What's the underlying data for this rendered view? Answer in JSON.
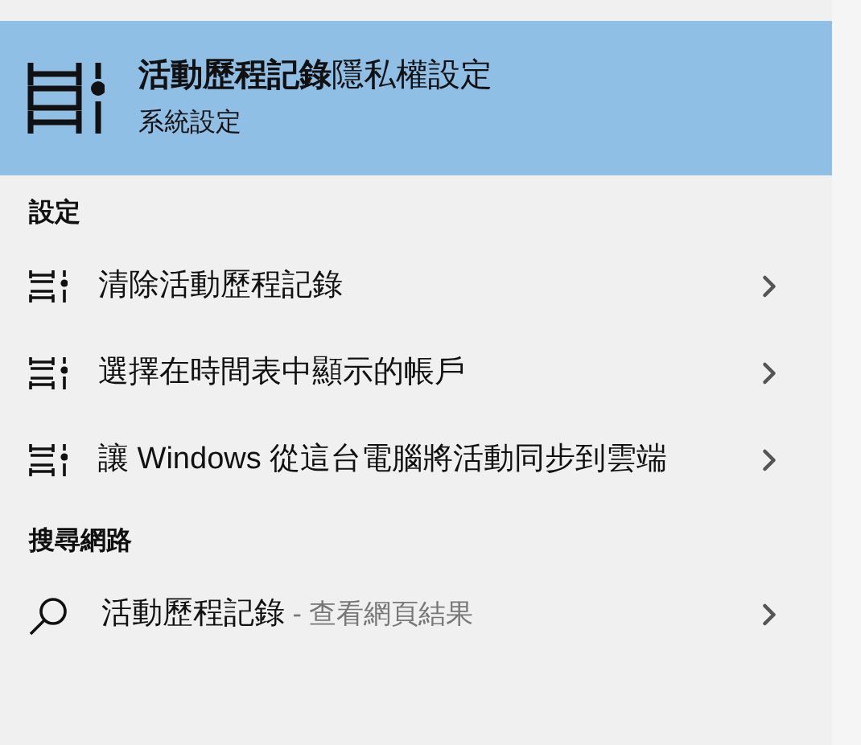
{
  "best_match": {
    "title": "**活動歷程記錄**隱私權設定",
    "subtitle": "系統設定",
    "selected": true
  },
  "sections": [
    {
      "heading": "設定",
      "items": [
        {
          "kind": "setting",
          "label": "清除活動歷程記錄"
        },
        {
          "kind": "setting",
          "label": "選擇在時間表中顯示的帳戶"
        },
        {
          "kind": "setting",
          "label": "讓 Windows 從這台電腦將活動同步到雲端"
        }
      ]
    },
    {
      "heading": "搜尋網路",
      "items": [
        {
          "kind": "web",
          "label": "活動歷程記錄",
          "hint": "- 查看網頁結果"
        }
      ]
    }
  ]
}
